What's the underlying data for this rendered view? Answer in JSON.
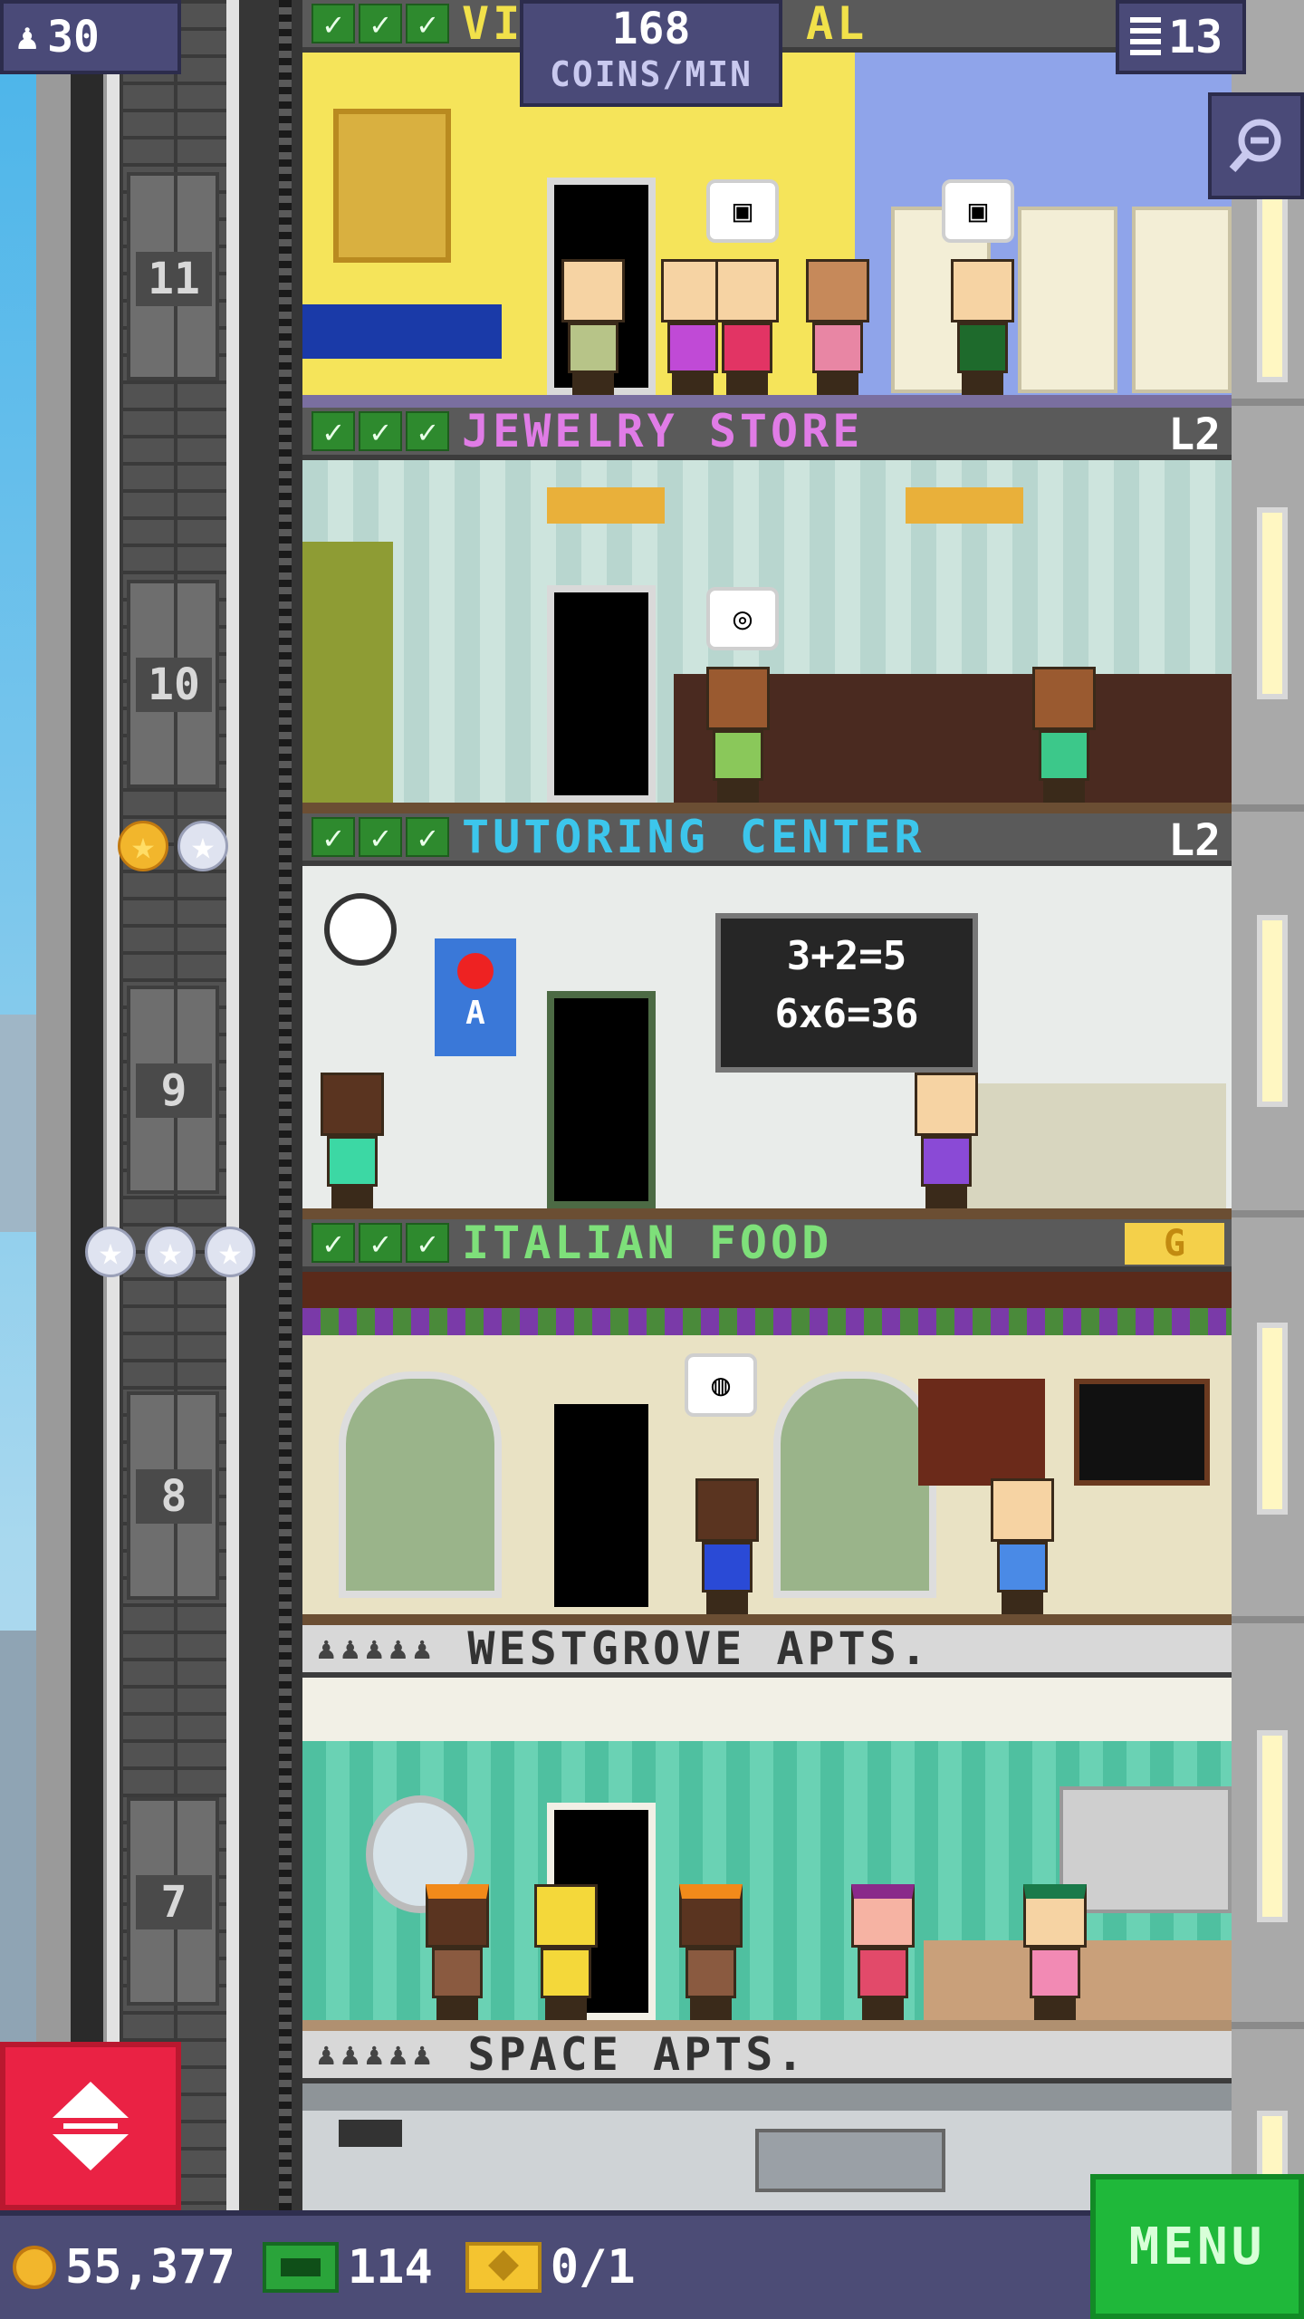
{
  "hud": {
    "residents_count": "30",
    "coins_per_min_value": "168",
    "coins_per_min_label": "COINS/MIN",
    "floors_count": "13",
    "elevator_button_icon": "up-down-arrows-icon",
    "zoom_icon": "zoom-out-icon"
  },
  "bottom_bar": {
    "coins": "55,377",
    "bux": "114",
    "tickets": "0/1",
    "menu_label": "MENU"
  },
  "elevator": {
    "floor_numbers": [
      "11",
      "10",
      "9",
      "8",
      "7"
    ],
    "star_rows": [
      {
        "gold": 1,
        "silver": 1
      },
      {
        "gold": 0,
        "silver": 3
      }
    ]
  },
  "floors": [
    {
      "name_fragment_left": "VI",
      "name_fragment_right": "AL",
      "checks": 3,
      "name_color": "#f1e14a",
      "room_color": "#f5e45a"
    },
    {
      "name": "JEWELRY STORE",
      "level": "L2",
      "checks": 3,
      "name_color": "#e07ce6",
      "room_color": "#cfe2de"
    },
    {
      "name": "TUTORING CENTER",
      "level": "L2",
      "checks": 3,
      "name_color": "#3cc6ec",
      "room_color": "#e9ecea",
      "chalkboard_line1": "3+2=5",
      "chalkboard_line2": "6x6=36",
      "poster_letter": "A"
    },
    {
      "name": "ITALIAN FOOD",
      "level_badge": "G",
      "checks": 3,
      "name_color": "#7ee07a",
      "room_color": "#e9e2c4"
    },
    {
      "name": "WESTGROVE APTS.",
      "residents_icon": "person-icon",
      "name_color": "#ffffff",
      "room_color": "#5fc8a8"
    },
    {
      "name": "SPACE APTS.",
      "residents_icon": "person-icon",
      "name_color": "#ffffff",
      "room_color": "#cfd3d6"
    }
  ]
}
